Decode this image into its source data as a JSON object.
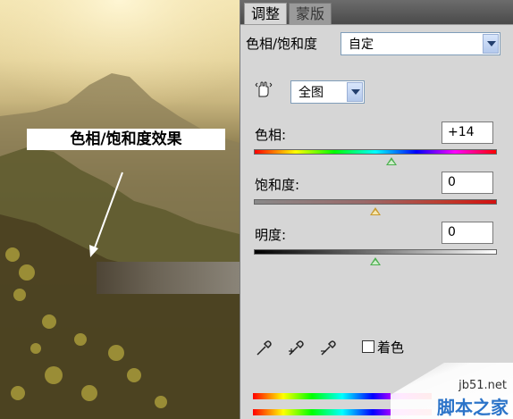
{
  "photo": {
    "callout_text": "色相/饱和度效果"
  },
  "panel": {
    "tabs": [
      {
        "label": "调整",
        "active": true
      },
      {
        "label": "蒙版",
        "active": false
      }
    ],
    "preset": {
      "label": "色相/饱和度",
      "value": "自定"
    },
    "channel": {
      "value": "全图"
    },
    "hue": {
      "label": "色相:",
      "value": "+14"
    },
    "saturation": {
      "label": "饱和度:",
      "value": "0"
    },
    "lightness": {
      "label": "明度:",
      "value": "0"
    },
    "colorize": {
      "label": "着色",
      "checked": false
    }
  },
  "watermark": {
    "url": "jb51.net",
    "site": "脚本之家"
  },
  "icons": [
    "hand-adjust-icon",
    "eyedropper-icon",
    "eyedropper-plus-icon",
    "eyedropper-minus-icon"
  ]
}
